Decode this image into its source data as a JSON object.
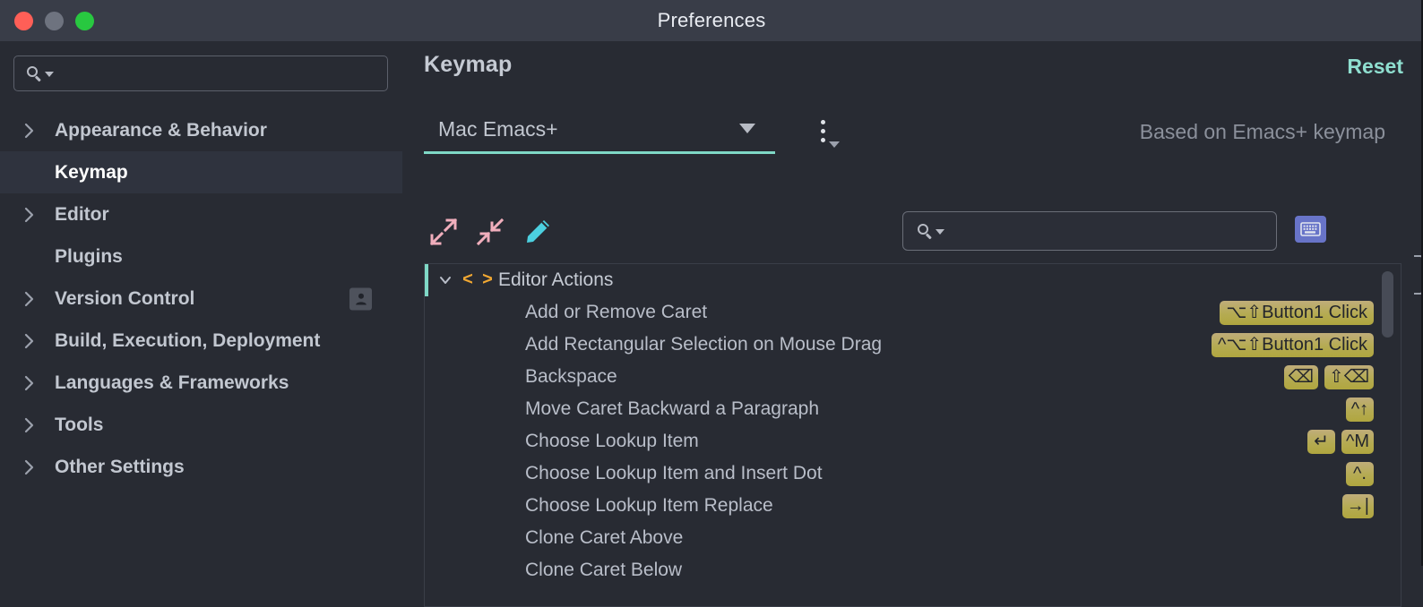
{
  "window": {
    "title": "Preferences",
    "traffic_lights": [
      "close",
      "minimize",
      "maximize"
    ],
    "colors": {
      "titlebar_bg": "#393d48",
      "body_bg": "#282b33",
      "accent_teal": "#7fd8c6",
      "badge_olive": "#b5ab52",
      "kbd_blue": "#6874c8",
      "folder_orange": "#f0a732",
      "icon_pink": "#f0aebc",
      "icon_cyan": "#4cd0e0"
    }
  },
  "sidebar": {
    "search": {
      "value": "",
      "placeholder": "",
      "icon": "search-icon"
    },
    "items": [
      {
        "label": "Appearance & Behavior",
        "expandable": true,
        "selected": false,
        "badge": null
      },
      {
        "label": "Keymap",
        "expandable": false,
        "selected": true,
        "badge": null
      },
      {
        "label": "Editor",
        "expandable": true,
        "selected": false,
        "badge": null
      },
      {
        "label": "Plugins",
        "expandable": false,
        "selected": false,
        "badge": null
      },
      {
        "label": "Version Control",
        "expandable": true,
        "selected": false,
        "badge": "user-icon"
      },
      {
        "label": "Build, Execution, Deployment",
        "expandable": true,
        "selected": false,
        "badge": null
      },
      {
        "label": "Languages & Frameworks",
        "expandable": true,
        "selected": false,
        "badge": null
      },
      {
        "label": "Tools",
        "expandable": true,
        "selected": false,
        "badge": null
      },
      {
        "label": "Other Settings",
        "expandable": true,
        "selected": false,
        "badge": null
      }
    ]
  },
  "main": {
    "title": "Keymap",
    "reset_label": "Reset",
    "keymap_select": {
      "value": "Mac Emacs+",
      "options": [
        "Mac Emacs+"
      ]
    },
    "based_on": "Based on Emacs+ keymap",
    "toolbar": {
      "expand_all": "expand-all-icon",
      "collapse_all": "collapse-all-icon",
      "edit": "edit-pencil-icon",
      "search": {
        "value": "",
        "placeholder": ""
      },
      "keyboard_button": "keyboard-icon"
    },
    "tree": {
      "rows": [
        {
          "type": "group",
          "name": "Editor Actions",
          "expanded": true,
          "icon": "code-brackets-icon",
          "shortcuts": []
        },
        {
          "type": "leaf",
          "name": "Add or Remove Caret",
          "shortcuts": [
            {
              "text": "⌥⇧Button1 Click",
              "wide": true
            }
          ]
        },
        {
          "type": "leaf",
          "name": "Add Rectangular Selection on Mouse Drag",
          "shortcuts": [
            {
              "text": "^⌥⇧Button1 Click",
              "wide": true
            }
          ]
        },
        {
          "type": "leaf",
          "name": "Backspace",
          "shortcuts": [
            {
              "text": "⌫",
              "wide": false
            },
            {
              "text": "⇧⌫",
              "wide": false
            }
          ]
        },
        {
          "type": "leaf",
          "name": "Move Caret Backward a Paragraph",
          "shortcuts": [
            {
              "text": "^↑",
              "wide": false
            }
          ]
        },
        {
          "type": "leaf",
          "name": "Choose Lookup Item",
          "shortcuts": [
            {
              "text": "↵",
              "wide": false
            },
            {
              "text": "^M",
              "wide": false
            }
          ]
        },
        {
          "type": "leaf",
          "name": "Choose Lookup Item and Insert Dot",
          "shortcuts": [
            {
              "text": "^.",
              "wide": false
            }
          ]
        },
        {
          "type": "leaf",
          "name": "Choose Lookup Item Replace",
          "shortcuts": [
            {
              "text": "→|",
              "wide": false
            }
          ]
        },
        {
          "type": "leaf",
          "name": "Clone Caret Above",
          "shortcuts": []
        },
        {
          "type": "leaf",
          "name": "Clone Caret Below",
          "shortcuts": []
        }
      ]
    }
  }
}
